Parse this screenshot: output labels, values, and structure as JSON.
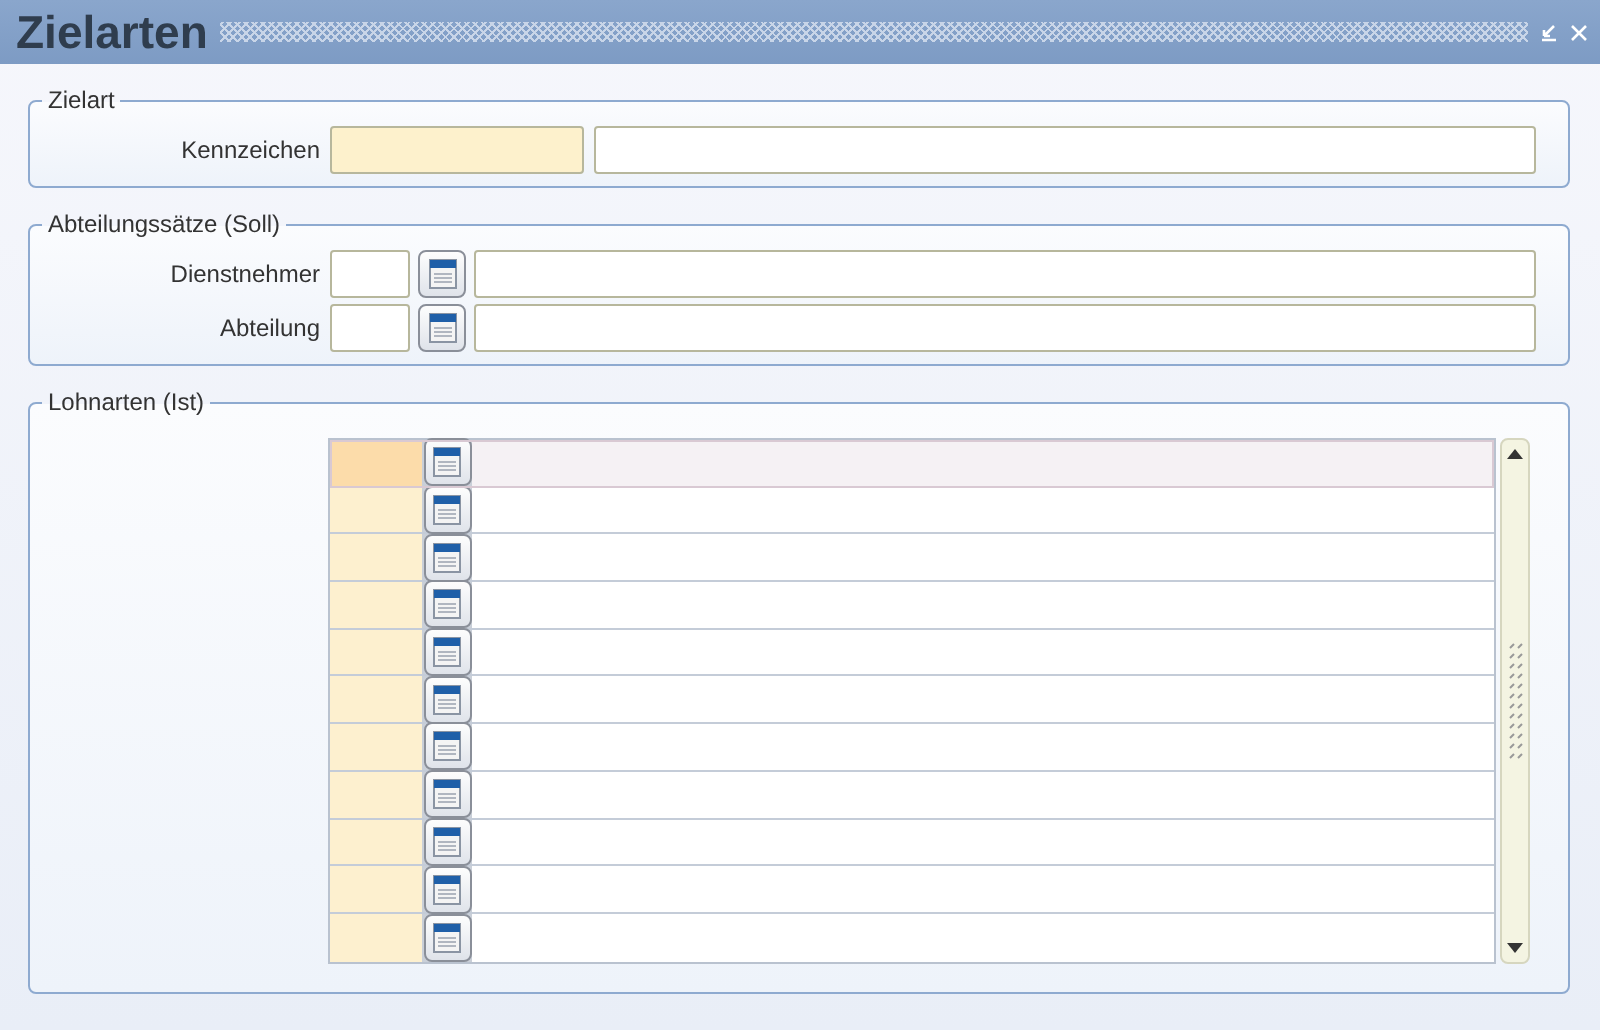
{
  "window": {
    "title": "Zielarten"
  },
  "sections": [
    {
      "legend": "Zielart",
      "fields": [
        {
          "label": "Kennzeichen",
          "kind": "code_desc",
          "required": true
        }
      ]
    },
    {
      "legend": "Abteilungssätze (Soll)",
      "fields": [
        {
          "label": "Dienstnehmer",
          "kind": "code_lookup_desc",
          "required": false
        },
        {
          "label": "Abteilung",
          "kind": "code_lookup_desc",
          "required": false
        }
      ]
    },
    {
      "legend": "Lohnarten (Ist)",
      "grid": {
        "rows": [
          {
            "selected": true
          },
          {
            "selected": false
          },
          {
            "selected": false
          },
          {
            "selected": false
          },
          {
            "selected": false
          },
          {
            "selected": false
          },
          {
            "selected": false
          },
          {
            "selected": false
          },
          {
            "selected": false
          },
          {
            "selected": false
          },
          {
            "selected": false
          }
        ]
      }
    }
  ]
}
